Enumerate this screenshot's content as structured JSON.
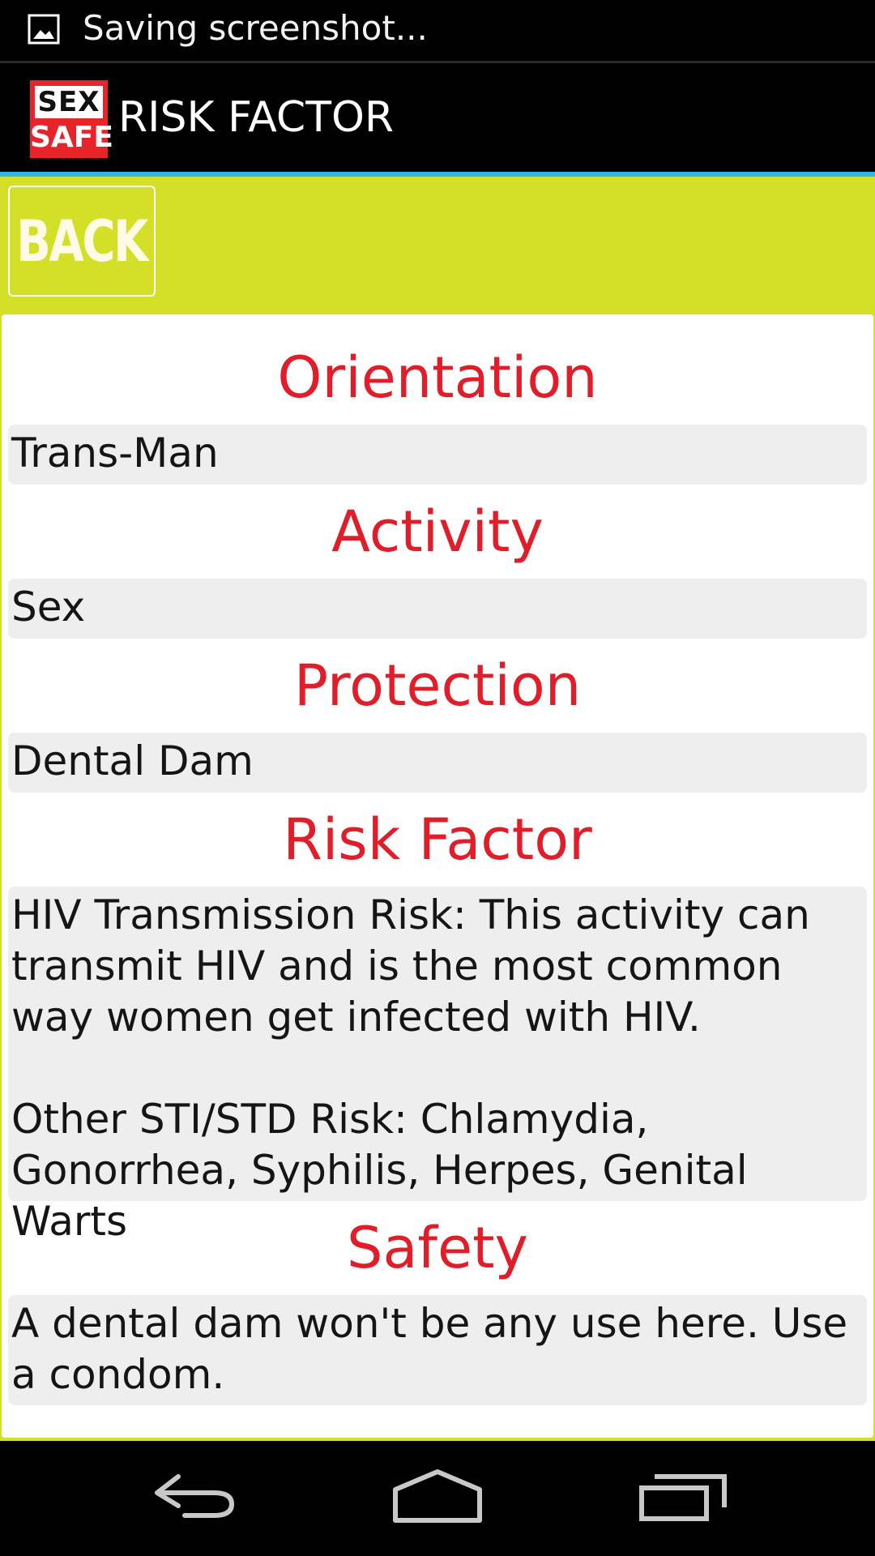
{
  "status_bar": {
    "notification_icon": "image-icon",
    "text": "Saving screenshot..."
  },
  "action_bar": {
    "logo_top": "SEX",
    "logo_bottom": "SAFE",
    "title": "RISK FACTOR"
  },
  "back_button": {
    "label": "BACK"
  },
  "sections": [
    {
      "title": "Orientation",
      "value": "Trans-Man"
    },
    {
      "title": "Activity",
      "value": "Sex"
    },
    {
      "title": "Protection",
      "value": "Dental Dam"
    },
    {
      "title": "Risk Factor",
      "value": "HIV Transmission Risk: This activity can transmit HIV and is the most common way women get infected with HIV.\n\nOther STI/STD Risk: Chlamydia, Gonorrhea, Syphilis, Herpes, Genital Warts"
    },
    {
      "title": "Safety",
      "value": "A dental dam won't be any use here. Use a condom."
    }
  ],
  "nav_bar": {
    "back_icon": "back-arrow-icon",
    "home_icon": "home-icon",
    "recents_icon": "recent-apps-icon"
  },
  "colors": {
    "accent_blue": "#33b5e5",
    "content_background": "#d4e027",
    "section_title": "#e21d2a",
    "value_background": "#eeeeee"
  }
}
